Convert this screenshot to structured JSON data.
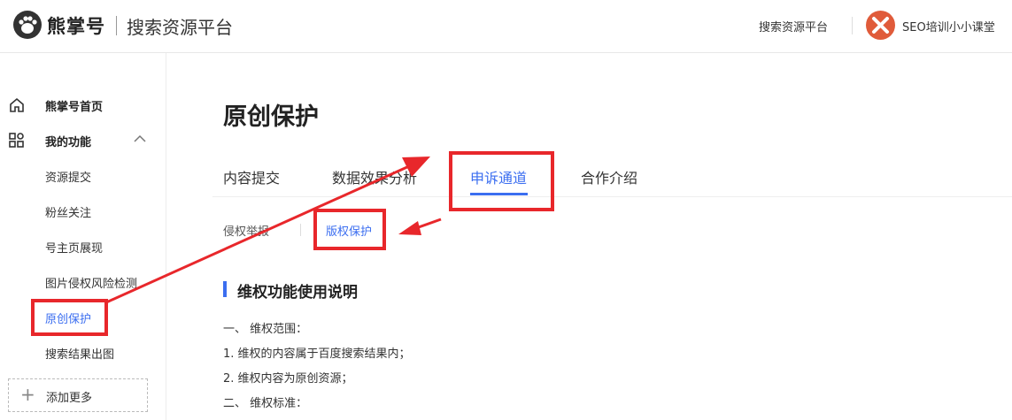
{
  "header": {
    "brand": "熊掌号",
    "platform": "搜索资源平台",
    "link": "搜索资源平台",
    "username": "SEO培训小小课堂"
  },
  "sidebar": {
    "home": "熊掌号首页",
    "my_functions": "我的功能",
    "items": [
      {
        "label": "资源提交"
      },
      {
        "label": "粉丝关注"
      },
      {
        "label": "号主页展现"
      },
      {
        "label": "图片侵权风险检测"
      },
      {
        "label": "原创保护",
        "active": true
      },
      {
        "label": "搜索结果出图"
      }
    ],
    "add_more": "添加更多"
  },
  "main": {
    "title": "原创保护",
    "tabs": [
      {
        "label": "内容提交"
      },
      {
        "label": "数据效果分析"
      },
      {
        "label": "申诉通道",
        "active": true
      },
      {
        "label": "合作介绍"
      }
    ],
    "subtabs": [
      {
        "label": "侵权举报"
      },
      {
        "label": "版权保护",
        "active": true
      }
    ],
    "section_title": "维权功能使用说明",
    "lines": [
      "一、 维权范围：",
      "1. 维权的内容属于百度搜索结果内；",
      "2. 维权内容为原创资源；",
      "二、 维权标准："
    ]
  },
  "colors": {
    "accent": "#3b6ef0",
    "annotation_red": "#e8272b"
  }
}
